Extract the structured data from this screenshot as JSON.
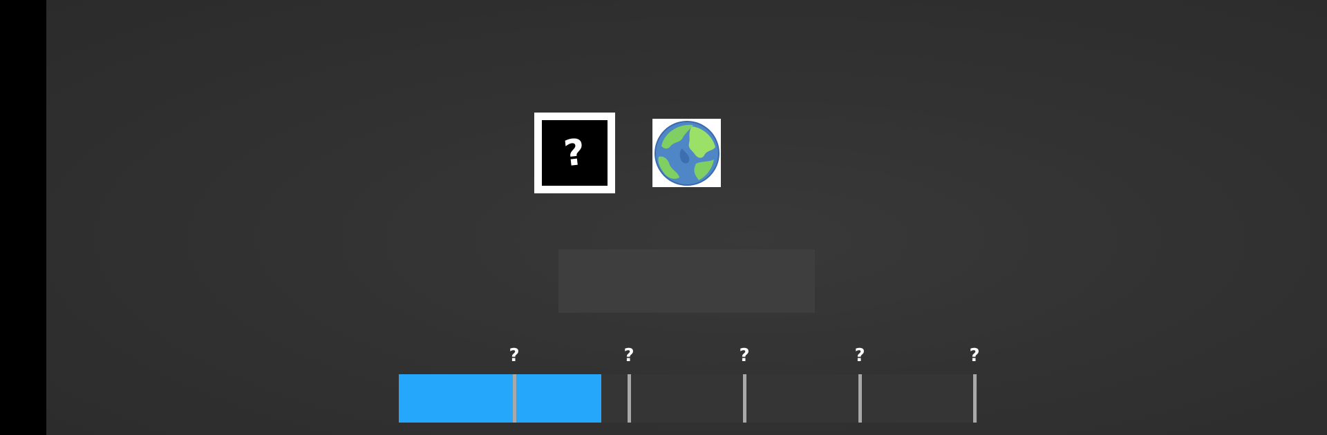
{
  "mystery_card": {
    "glyph": "?"
  },
  "earth_card": {
    "icon": "earth-icon"
  },
  "answer_box": {
    "text": ""
  },
  "progress": {
    "fill_fraction": 0.35,
    "fill_color": "#25a8fb",
    "markers": [
      {
        "label": "?"
      },
      {
        "label": "?"
      },
      {
        "label": "?"
      },
      {
        "label": "?"
      },
      {
        "label": "?"
      }
    ]
  }
}
